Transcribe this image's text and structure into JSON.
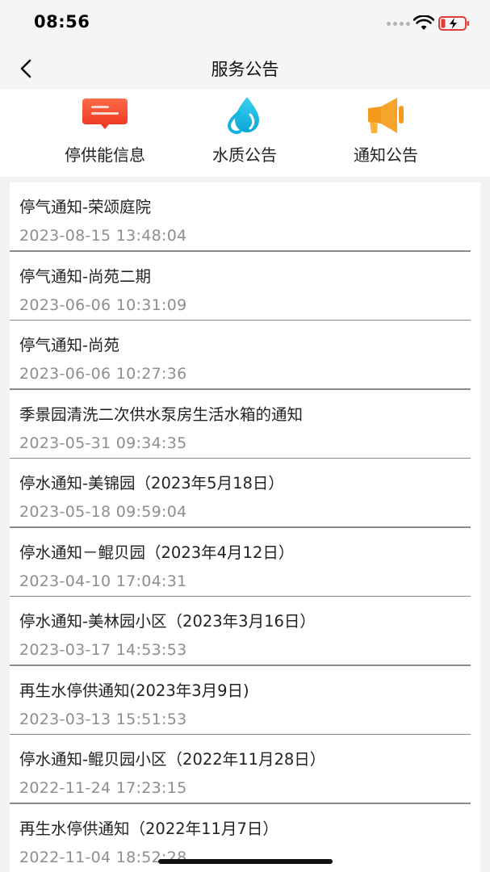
{
  "status_bar": {
    "time": "08:56"
  },
  "nav": {
    "title": "服务公告"
  },
  "categories": [
    {
      "label": "停供能信息",
      "icon": "notice-card-icon",
      "color": "#f5452e"
    },
    {
      "label": "水质公告",
      "icon": "water-drop-icon",
      "color": "#17b8e0"
    },
    {
      "label": "通知公告",
      "icon": "megaphone-icon",
      "color": "#f59a1b"
    }
  ],
  "notices": [
    {
      "title": "停气通知-荣颂庭院",
      "date": "2023-08-15 13:48:04"
    },
    {
      "title": "停气通知-尚苑二期",
      "date": "2023-06-06 10:31:09"
    },
    {
      "title": "停气通知-尚苑",
      "date": "2023-06-06 10:27:36"
    },
    {
      "title": "季景园清洗二次供水泵房生活水箱的通知",
      "date": "2023-05-31 09:34:35"
    },
    {
      "title": "停水通知-美锦园（2023年5月18日）",
      "date": "2023-05-18 09:59:04"
    },
    {
      "title": "停水通知－鲲贝园（2023年4月12日）",
      "date": "2023-04-10 17:04:31"
    },
    {
      "title": "停水通知-美林园小区（2023年3月16日）",
      "date": "2023-03-17 14:53:53"
    },
    {
      "title": "再生水停供通知(2023年3月9日)",
      "date": "2023-03-13 15:51:53"
    },
    {
      "title": "停水通知-鲲贝园小区（2022年11月28日）",
      "date": "2022-11-24 17:23:15"
    },
    {
      "title": "再生水停供通知（2022年11月7日）",
      "date": "2022-11-04 18:52:28"
    }
  ]
}
